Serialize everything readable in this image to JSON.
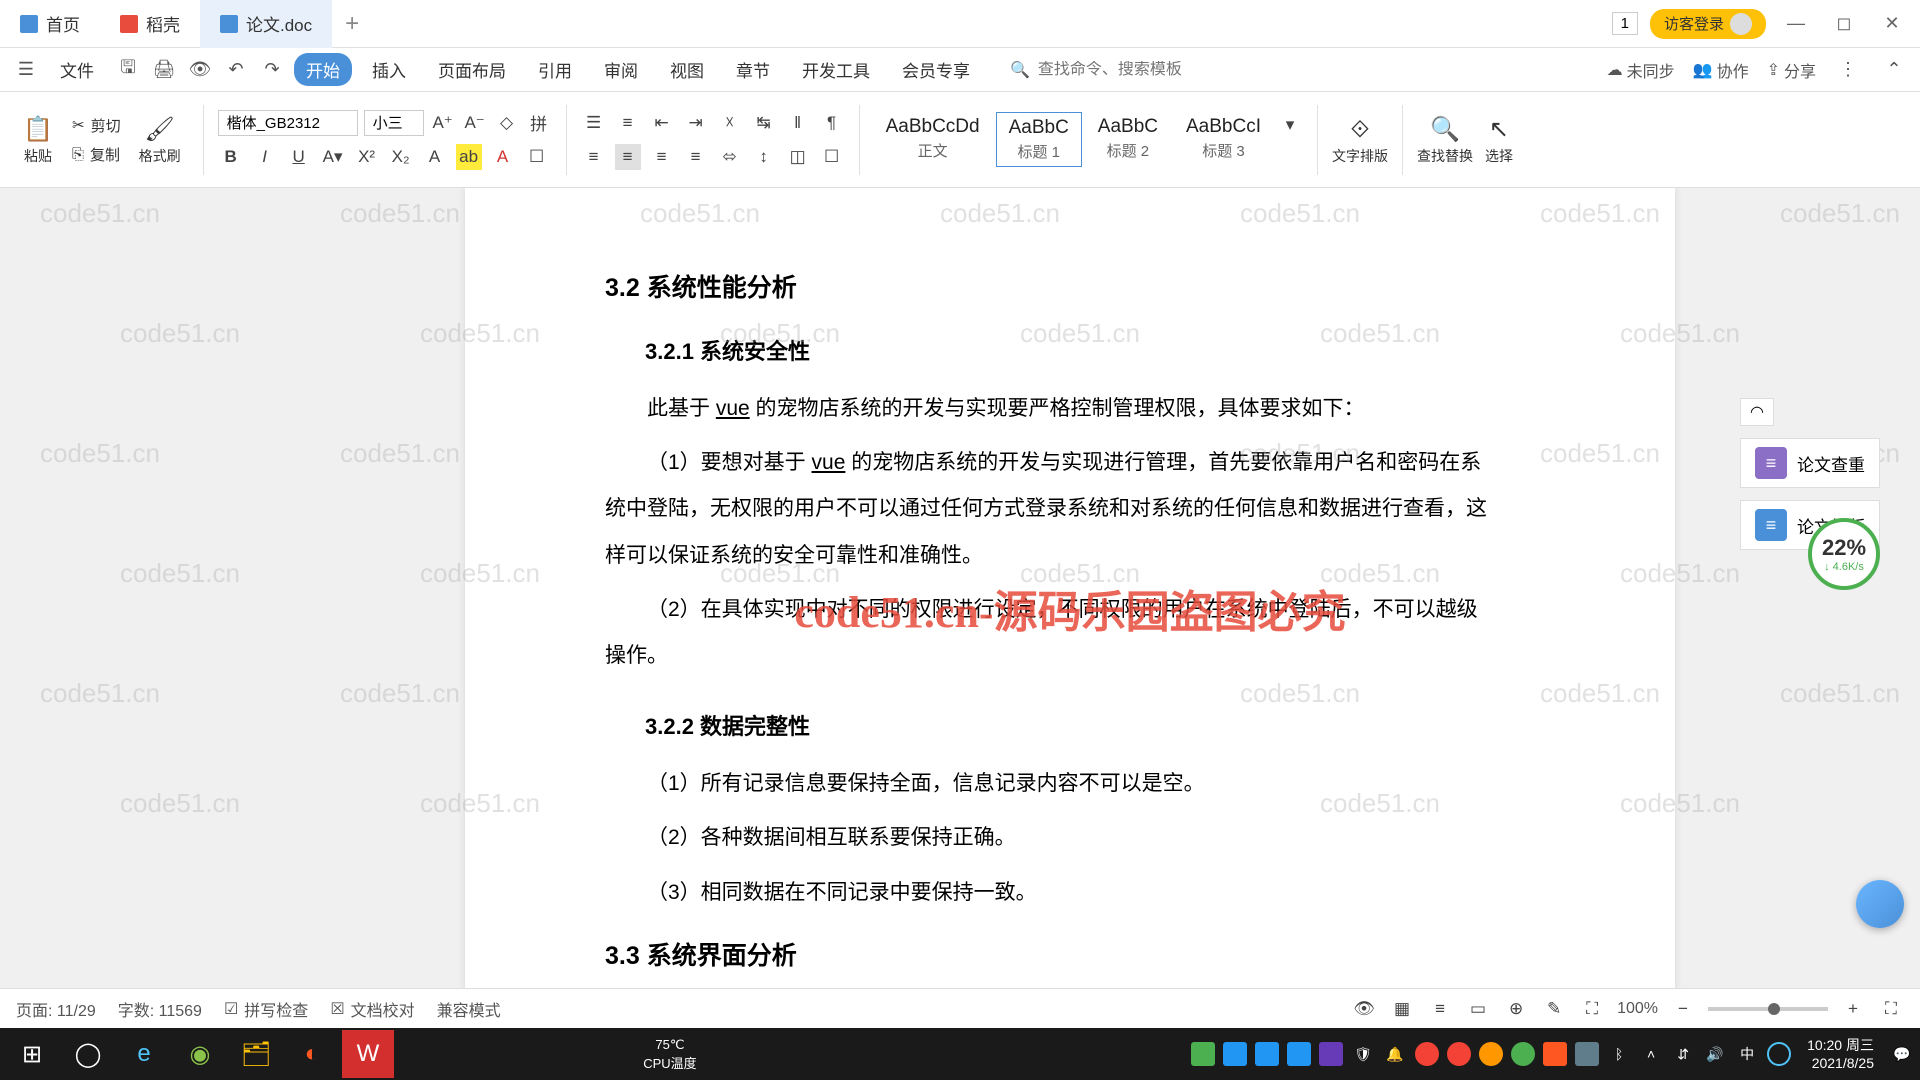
{
  "tabs": {
    "home": "首页",
    "dk": "稻壳",
    "doc": "论文.doc",
    "add": "+"
  },
  "titlebar": {
    "num": "1",
    "login": "访客登录"
  },
  "menu": {
    "file": "文件",
    "start": "开始",
    "insert": "插入",
    "layout": "页面布局",
    "ref": "引用",
    "review": "审阅",
    "view": "视图",
    "chapter": "章节",
    "dev": "开发工具",
    "member": "会员专享",
    "search_placeholder": "查找命令、搜索模板"
  },
  "menuright": {
    "unsync": "未同步",
    "collab": "协作",
    "share": "分享"
  },
  "ribbon": {
    "paste": "粘贴",
    "cut": "剪切",
    "copy": "复制",
    "format": "格式刷",
    "font": "楷体_GB2312",
    "size": "小三",
    "style_body_prev": "AaBbCcDd",
    "style_body": "正文",
    "style_h1_prev": "AaBbC",
    "style_h1": "标题 1",
    "style_h2_prev": "AaBbC",
    "style_h2": "标题 2",
    "style_h3_prev": "AaBbCcI",
    "style_h3": "标题 3",
    "textdir": "文字排版",
    "findrep": "查找替换",
    "select": "选择"
  },
  "doc": {
    "h2_32": "3.2 系统性能分析",
    "h3_321": "3.2.1  系统安全性",
    "p1_a": "此基于 ",
    "p1_vue": "vue",
    "p1_b": " 的宠物店系统的开发与实现要严格控制管理权限，具体要求如下：",
    "p2_a": "（1）要想对基于 ",
    "p2_vue": "vue",
    "p2_b": " 的宠物店系统的开发与实现进行管理，首先要依靠用户名和密码在系统中登陆，无权限的用户不可以通过任何方式登录系统和对系统的任何信息和数据进行查看，这样可以保证系统的安全可靠性和准确性。",
    "p3": "（2）在具体实现中对不同的权限进行设定，不同权限的用户在系统中登陆后，不可以越级操作。",
    "h3_322": "3.2.2  数据完整性",
    "p4": "（1）所有记录信息要保持全面，信息记录内容不可以是空。",
    "p5": "（2）各种数据间相互联系要保持正确。",
    "p6": "（3）相同数据在不同记录中要保持一致。",
    "h2_33": "3.3 系统界面分析",
    "watermark_center": "code51.cn-源码乐园盗图必究",
    "watermark": "code51.cn"
  },
  "side": {
    "check": "论文查重",
    "layout": "论文排版"
  },
  "speed": {
    "pct": "22%",
    "rate": "↓ 4.6K/s"
  },
  "status": {
    "page": "页面: 11/29",
    "words": "字数: 11569",
    "spell": "拼写检查",
    "proof": "文档校对",
    "compat": "兼容模式",
    "zoom": "100%"
  },
  "taskbar": {
    "temp": "75℃",
    "cpu": "CPU温度",
    "time": "10:20 周三",
    "date": "2021/8/25"
  }
}
